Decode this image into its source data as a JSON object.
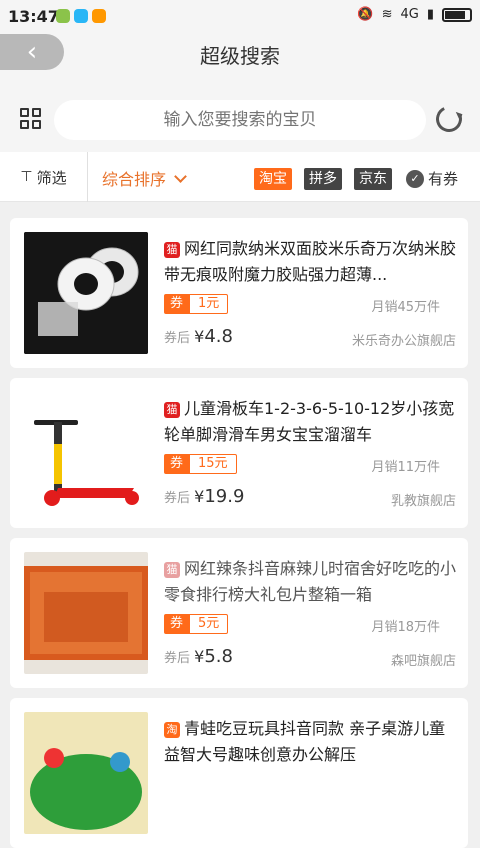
{
  "status": {
    "time": "13:47",
    "net": "4G"
  },
  "header": {
    "title": "超级搜索",
    "back_icon": "chevron-left-icon"
  },
  "search": {
    "placeholder": "输入您要搜索的宝贝"
  },
  "filters": {
    "filter_label": "筛选",
    "sort_label": "综合排序",
    "platforms": [
      "淘宝",
      "拼多",
      "京东"
    ],
    "coupon_label": "有券"
  },
  "products": [
    {
      "name": "网红同款纳米双面胶米乐奇万次纳米胶带无痕吸附魔力胶贴强力超薄...",
      "coupon_tag": "券",
      "coupon": "1元",
      "sales": "月销45万件",
      "price_label": "券后",
      "currency": "¥",
      "price": "4.8",
      "store": "米乐奇办公旗舰店",
      "shop_icon": "tmall-icon"
    },
    {
      "name": "儿童滑板车1-2-3-6-5-10-12岁小孩宽轮单脚滑滑车男女宝宝溜溜车",
      "coupon_tag": "券",
      "coupon": "15元",
      "sales": "月销11万件",
      "price_label": "券后",
      "currency": "¥",
      "price": "19.9",
      "store": "乳教旗舰店",
      "shop_icon": "tmall-icon"
    },
    {
      "name": "网红辣条抖音麻辣儿时宿舍好吃吃的小零食排行榜大礼包片整箱一箱",
      "coupon_tag": "券",
      "coupon": "5元",
      "sales": "月销18万件",
      "price_label": "券后",
      "currency": "¥",
      "price": "5.8",
      "store": "森吧旗舰店",
      "shop_icon": "tmall-icon"
    },
    {
      "name": "青蛙吃豆玩具抖音同款 亲子桌游儿童 益智大号趣味创意办公解压",
      "coupon_tag": "",
      "coupon": "",
      "sales": "",
      "price_label": "",
      "currency": "",
      "price": "",
      "store": "",
      "shop_icon": "taobao-icon"
    }
  ]
}
